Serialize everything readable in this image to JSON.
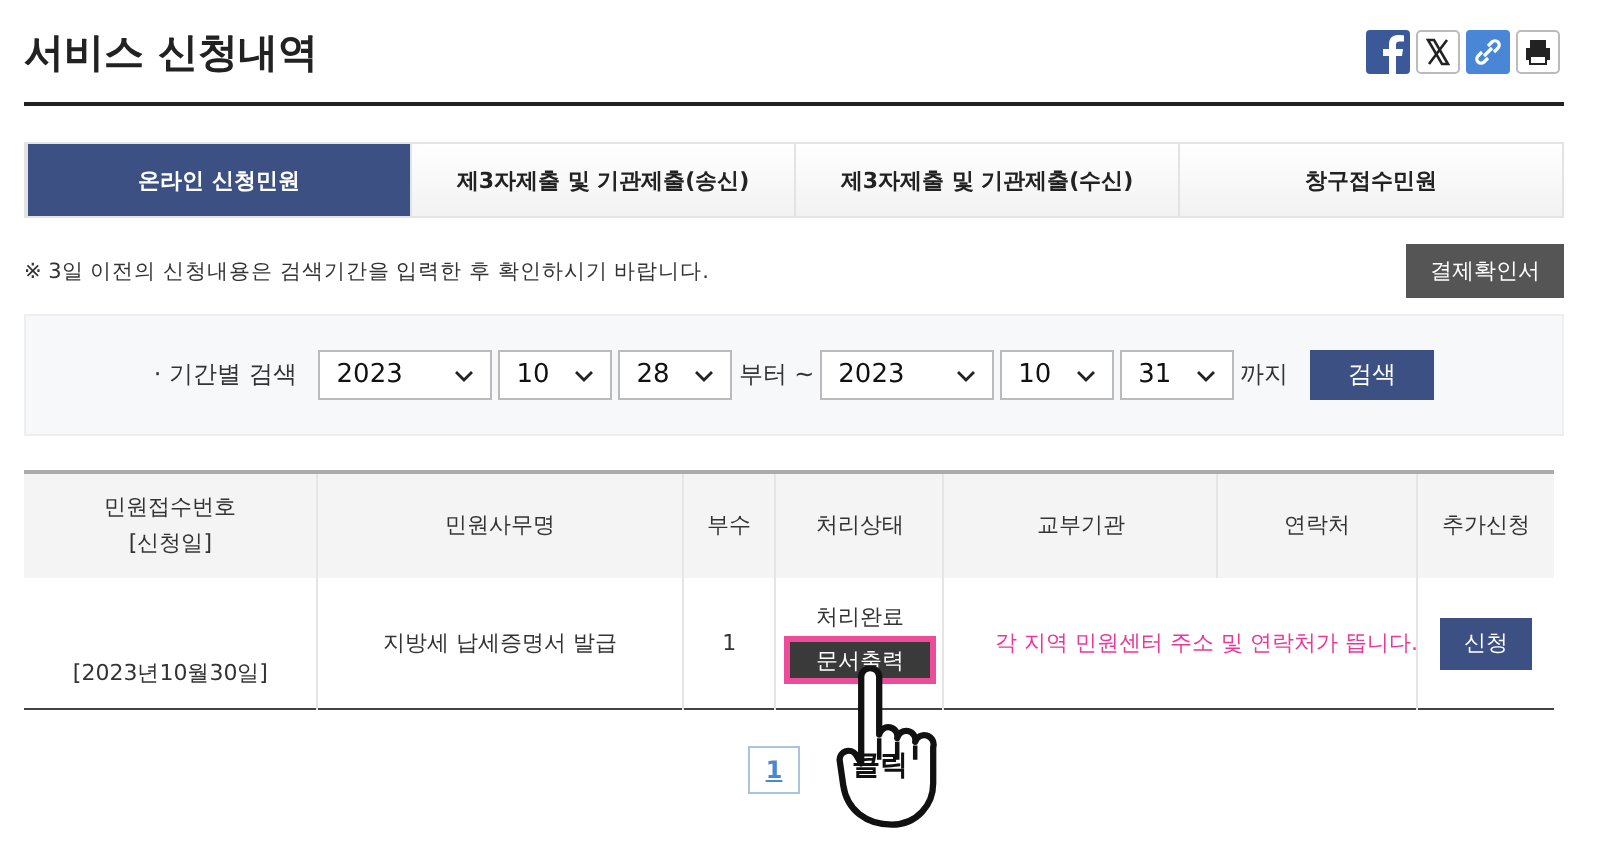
{
  "title": "서비스 신청내역",
  "share_icons": [
    {
      "kind": "facebook"
    },
    {
      "kind": "x"
    },
    {
      "kind": "link"
    },
    {
      "kind": "print"
    }
  ],
  "tabs": [
    {
      "label": "온라인 신청민원",
      "selected": true
    },
    {
      "label": "제3자제출 및 기관제출(송신)",
      "selected": false
    },
    {
      "label": "제3자제출 및 기관제출(수신)",
      "selected": false
    },
    {
      "label": "창구접수민원",
      "selected": false
    }
  ],
  "notice": "※ 3일 이전의 신청내용은 검색기간을 입력한 후 확인하시기 바랍니다.",
  "receipt_button": "결제확인서",
  "search": {
    "label": "· 기간별 검색",
    "from": [
      "2023",
      "10",
      "28"
    ],
    "from_suffix": "부터 ~",
    "to": [
      "2023",
      "10",
      "31"
    ],
    "to_suffix": "까지",
    "button": "검색"
  },
  "table": {
    "columns": [
      [
        "민원접수번호",
        "[신청일]"
      ],
      [
        "민원사무명"
      ],
      [
        "부수"
      ],
      [
        "처리상태"
      ],
      [
        "교부기관"
      ],
      [
        "연락처"
      ],
      [
        "추가신청"
      ]
    ],
    "rows": [
      {
        "date": "[2023년10월30일]",
        "name": "지방세 납세증명서 발급",
        "copies": "1",
        "status": "처리완료",
        "print_button": "문서출력",
        "note": "각 지역 민원센터 주소 및 연락처가 뜹니다.",
        "apply_button": "신청"
      }
    ]
  },
  "pagination": [
    {
      "label": "1",
      "selected": true
    }
  ],
  "annotation": {
    "label": "클릭"
  }
}
